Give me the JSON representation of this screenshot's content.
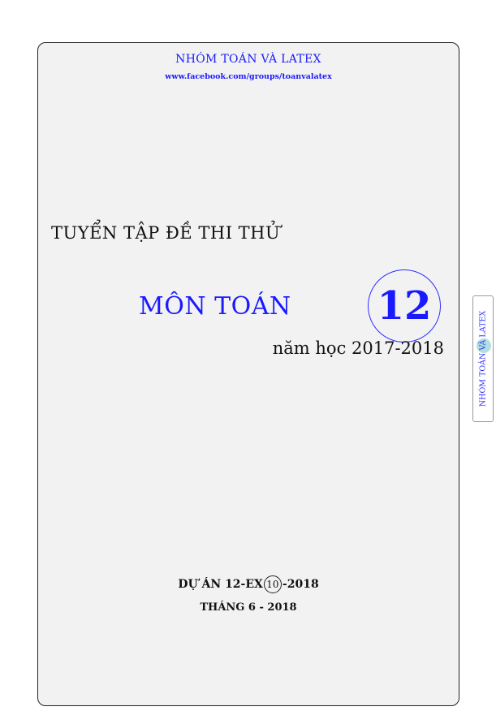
{
  "header": {
    "group_name": "NHÓM TOÁN VÀ LATEX",
    "group_url": "www.facebook.com/groups/toanvalatex"
  },
  "cover": {
    "collection_title": "TUYỂN TẬP ĐỀ THI THỬ",
    "subject": "MÔN TOÁN",
    "grade": "12",
    "school_year": "năm học 2017-2018"
  },
  "footer": {
    "project_prefix": "DỰ ÁN 12-EX",
    "project_code": "10",
    "project_suffix": "-2018",
    "date": "THÁNG 6 - 2018"
  },
  "side_tab": {
    "label": "NHÓM TOÁN VÀ LATEX"
  },
  "colors": {
    "accent_blue": "#1a1aff",
    "page_background": "#f2f2f2",
    "tab_dot": "#9ed6d6"
  }
}
